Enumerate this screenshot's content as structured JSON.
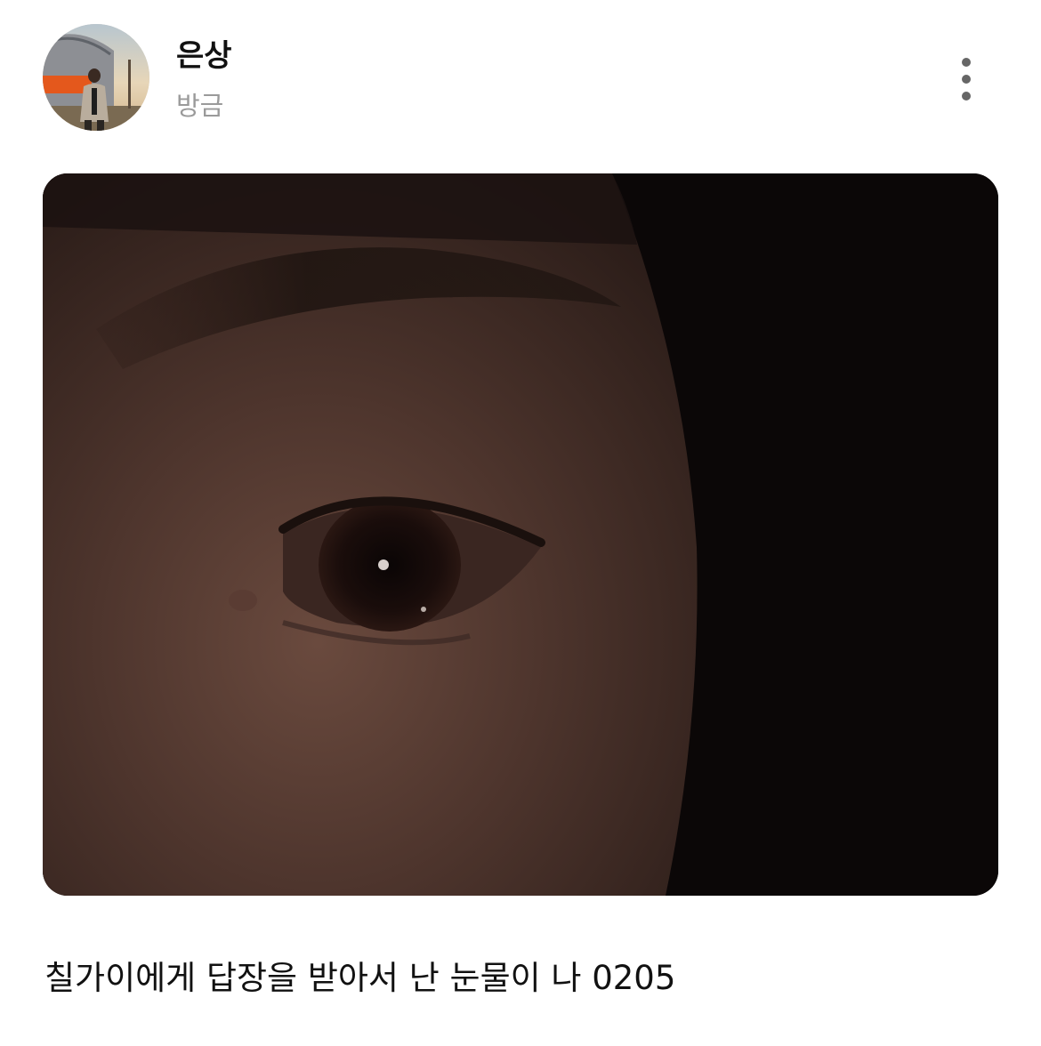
{
  "post": {
    "author": {
      "name": "은상",
      "avatar_icon": "profile-photo"
    },
    "time": "방금",
    "menu_icon": "more-vertical-icon",
    "photo_icon": "eye-closeup-photo",
    "caption": "칠가이에게 답장을 받아서 난 눈물이 나 0205"
  },
  "colors": {
    "text": "#111111",
    "muted": "#9a9a9a",
    "menu_dots": "#666666",
    "background": "#ffffff"
  }
}
